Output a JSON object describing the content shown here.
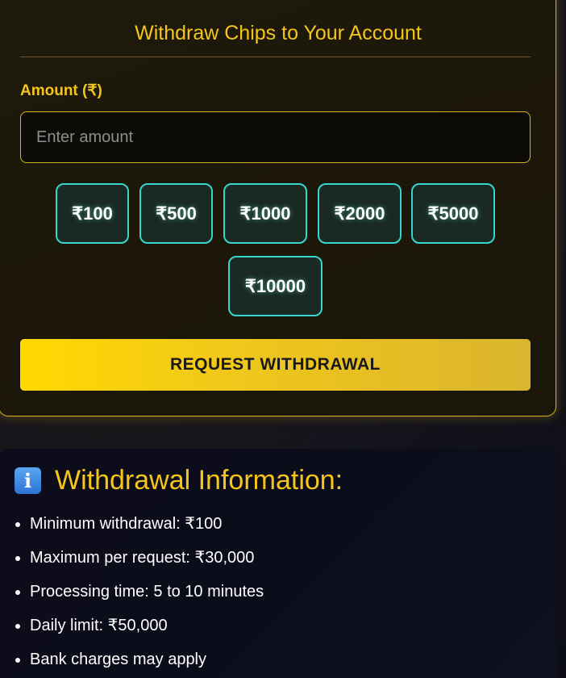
{
  "withdraw_card": {
    "title": "Withdraw Chips to Your Account",
    "amount_label": "Amount (₹)",
    "amount_placeholder": "Enter amount",
    "amount_value": "",
    "chips": [
      "₹100",
      "₹500",
      "₹1000",
      "₹2000",
      "₹5000",
      "₹10000"
    ],
    "request_button_label": "REQUEST WITHDRAWAL"
  },
  "info": {
    "icon": "info-icon",
    "title": "Withdrawal Information:",
    "items": [
      "Minimum withdrawal: ₹100",
      "Maximum per request: ₹30,000",
      "Processing time: 5 to 10 minutes",
      "Daily limit: ₹50,000",
      "Bank charges may apply"
    ]
  },
  "colors": {
    "accent_gold": "#f5c51a",
    "chip_border": "#36d6cf",
    "page_background": "#15141e"
  }
}
